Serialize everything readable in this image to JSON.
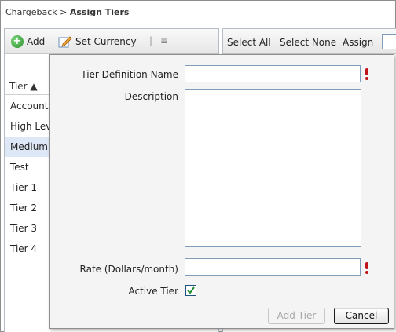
{
  "breadcrumb": {
    "parent": "Chargeback",
    "separator": " > ",
    "current": "Assign Tiers"
  },
  "left_toolbar": {
    "add_label": "Add",
    "set_currency_label": "Set Currency",
    "separator": "|",
    "list_icon": "≡"
  },
  "tier_list": {
    "column_header": "Tier ▲",
    "rows": [
      "Account",
      "High Lev",
      "Medium",
      "Test",
      "Tier 1 -",
      "Tier 2",
      "Tier 3",
      "Tier 4"
    ]
  },
  "right_toolbar": {
    "select_all": "Select All",
    "select_none": "Select None",
    "assign": "Assign"
  },
  "dialog": {
    "name_label": "Tier Definition Name",
    "name_value": "",
    "description_label": "Description",
    "description_value": "",
    "rate_label": "Rate (Dollars/month)",
    "rate_value": "",
    "active_label": "Active Tier",
    "active_checked": true,
    "add_button": "Add Tier",
    "cancel_button": "Cancel"
  },
  "colors": {
    "required_marker": "#c0141a",
    "selected_row": "#dde7f5",
    "checkmark": "#1f8a2d"
  }
}
